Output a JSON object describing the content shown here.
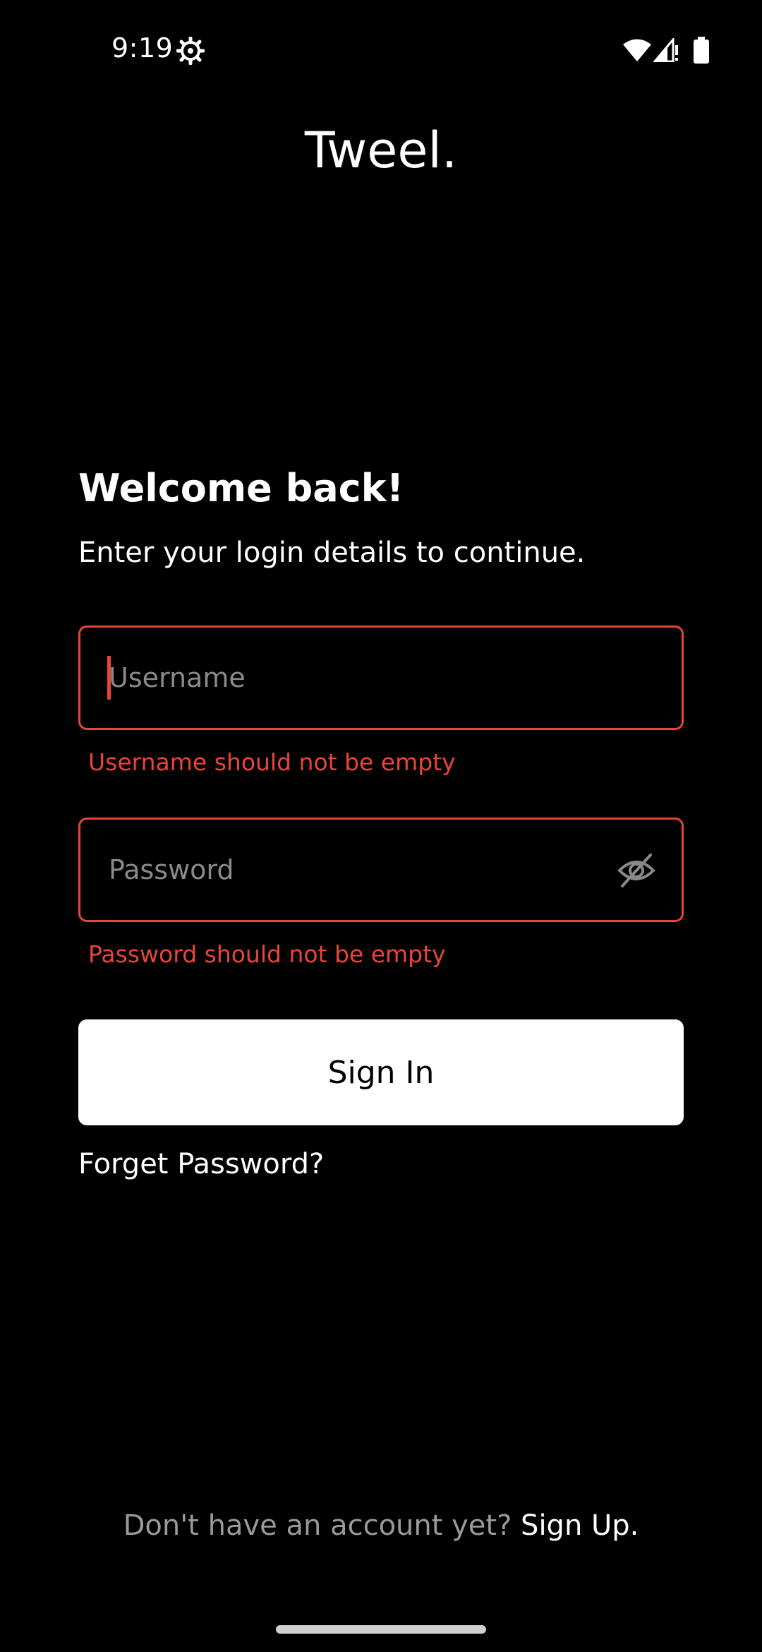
{
  "status_bar": {
    "time": "9:19",
    "icons": [
      "gear-icon",
      "wifi-icon",
      "signal-icon",
      "battery-icon"
    ]
  },
  "brand": {
    "title": "Tweel."
  },
  "login": {
    "heading": "Welcome back!",
    "subtitle": "Enter your login details to continue.",
    "username": {
      "placeholder": "Username",
      "value": "",
      "error": "Username should not be empty"
    },
    "password": {
      "placeholder": "Password",
      "value": "",
      "error": "Password should not be empty",
      "toggle_icon": "eye-off-icon"
    },
    "signin_label": "Sign In",
    "forgot_label": "Forget Password?"
  },
  "footer": {
    "prompt": "Don't have an account yet?",
    "signup_label": "Sign Up."
  },
  "colors": {
    "background": "#000000",
    "error": "#e8453a",
    "button_bg": "#ffffff",
    "muted_text": "#9a9a9a"
  }
}
